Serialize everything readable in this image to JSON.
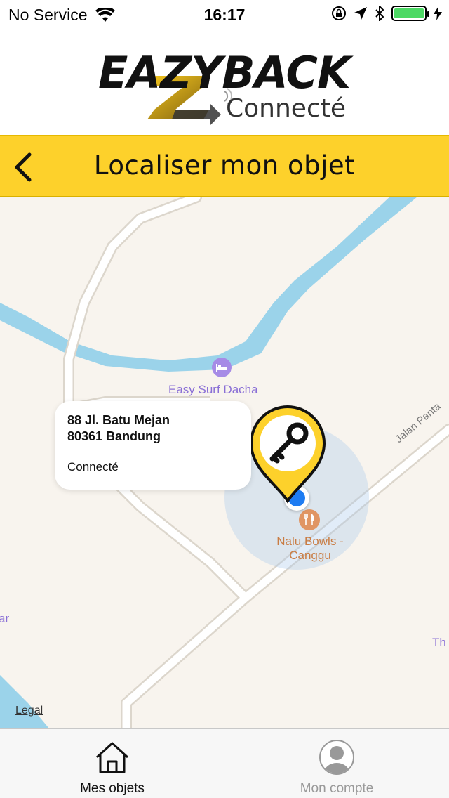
{
  "status_bar": {
    "carrier": "No Service",
    "time": "16:17",
    "battery_level": 1.0,
    "battery_color": "#4cd964"
  },
  "header": {
    "logo_word": "EAZYBACK",
    "logo_sub": "Connecté"
  },
  "title_bar": {
    "title": "Localiser mon objet",
    "background": "#fdd12b",
    "back_icon": "chevron-left-icon"
  },
  "map": {
    "pois": [
      {
        "name": "Easy Surf Dacha",
        "type": "hotel",
        "color": "#8a6fd6"
      },
      {
        "name": "Nalu Bowls -\nCanggu",
        "type": "restaurant",
        "color": "#c97c43"
      }
    ],
    "street_label": "Jalan Panta",
    "edge_label_left": "ar",
    "edge_label_right": "Th",
    "legal": "Legal",
    "callout": {
      "address_line1": "88 Jl. Batu Mejan",
      "address_line2": "80361 Bandung",
      "status": "Connecté"
    },
    "marker": {
      "icon": "key-icon",
      "color": "#fdd12b"
    }
  },
  "tab_bar": {
    "tabs": [
      {
        "label": "Mes objets",
        "icon": "home-icon",
        "active": true
      },
      {
        "label": "Mon compte",
        "icon": "user-avatar-icon",
        "active": false
      }
    ]
  }
}
